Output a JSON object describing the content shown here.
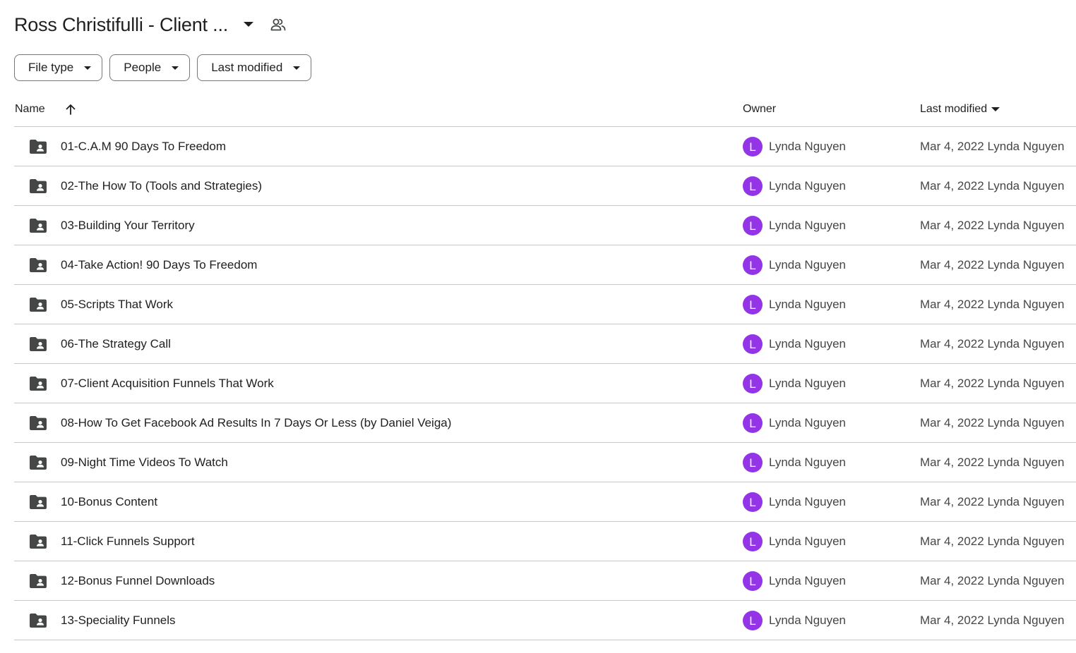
{
  "header": {
    "folder_title": "Ross Christifulli - Client ...",
    "title_menu_icon": "arrow-drop-down-icon",
    "share_icon": "shared-people-icon"
  },
  "filters": [
    {
      "label": "File type"
    },
    {
      "label": "People"
    },
    {
      "label": "Last modified"
    }
  ],
  "table": {
    "columns": {
      "name": "Name",
      "owner": "Owner",
      "last_modified": "Last modified"
    },
    "sort": {
      "column": "Name",
      "direction": "ascending"
    },
    "rows": [
      {
        "name": "01-C.A.M 90 Days To Freedom",
        "owner_initial": "L",
        "owner": "Lynda Nguyen",
        "modified": "Mar 4, 2022 Lynda Nguyen"
      },
      {
        "name": "02-The How To (Tools and Strategies)",
        "owner_initial": "L",
        "owner": "Lynda Nguyen",
        "modified": "Mar 4, 2022 Lynda Nguyen"
      },
      {
        "name": "03-Building Your Territory",
        "owner_initial": "L",
        "owner": "Lynda Nguyen",
        "modified": "Mar 4, 2022 Lynda Nguyen"
      },
      {
        "name": "04-Take Action! 90 Days To Freedom",
        "owner_initial": "L",
        "owner": "Lynda Nguyen",
        "modified": "Mar 4, 2022 Lynda Nguyen"
      },
      {
        "name": "05-Scripts That Work",
        "owner_initial": "L",
        "owner": "Lynda Nguyen",
        "modified": "Mar 4, 2022 Lynda Nguyen"
      },
      {
        "name": "06-The Strategy Call",
        "owner_initial": "L",
        "owner": "Lynda Nguyen",
        "modified": "Mar 4, 2022 Lynda Nguyen"
      },
      {
        "name": "07-Client Acquisition Funnels That Work",
        "owner_initial": "L",
        "owner": "Lynda Nguyen",
        "modified": "Mar 4, 2022 Lynda Nguyen"
      },
      {
        "name": "08-How To Get Facebook Ad Results In 7 Days Or Less (by Daniel Veiga)",
        "owner_initial": "L",
        "owner": "Lynda Nguyen",
        "modified": "Mar 4, 2022 Lynda Nguyen"
      },
      {
        "name": "09-Night Time Videos To Watch",
        "owner_initial": "L",
        "owner": "Lynda Nguyen",
        "modified": "Mar 4, 2022 Lynda Nguyen"
      },
      {
        "name": "10-Bonus Content",
        "owner_initial": "L",
        "owner": "Lynda Nguyen",
        "modified": "Mar 4, 2022 Lynda Nguyen"
      },
      {
        "name": "11-Click Funnels Support",
        "owner_initial": "L",
        "owner": "Lynda Nguyen",
        "modified": "Mar 4, 2022 Lynda Nguyen"
      },
      {
        "name": "12-Bonus Funnel Downloads",
        "owner_initial": "L",
        "owner": "Lynda Nguyen",
        "modified": "Mar 4, 2022 Lynda Nguyen"
      },
      {
        "name": "13-Speciality Funnels",
        "owner_initial": "L",
        "owner": "Lynda Nguyen",
        "modified": "Mar 4, 2022 Lynda Nguyen"
      }
    ]
  },
  "colors": {
    "avatar": "#9334e6",
    "folder_icon": "#444746",
    "divider": "#c7c7c7",
    "chip_border": "#747775"
  }
}
